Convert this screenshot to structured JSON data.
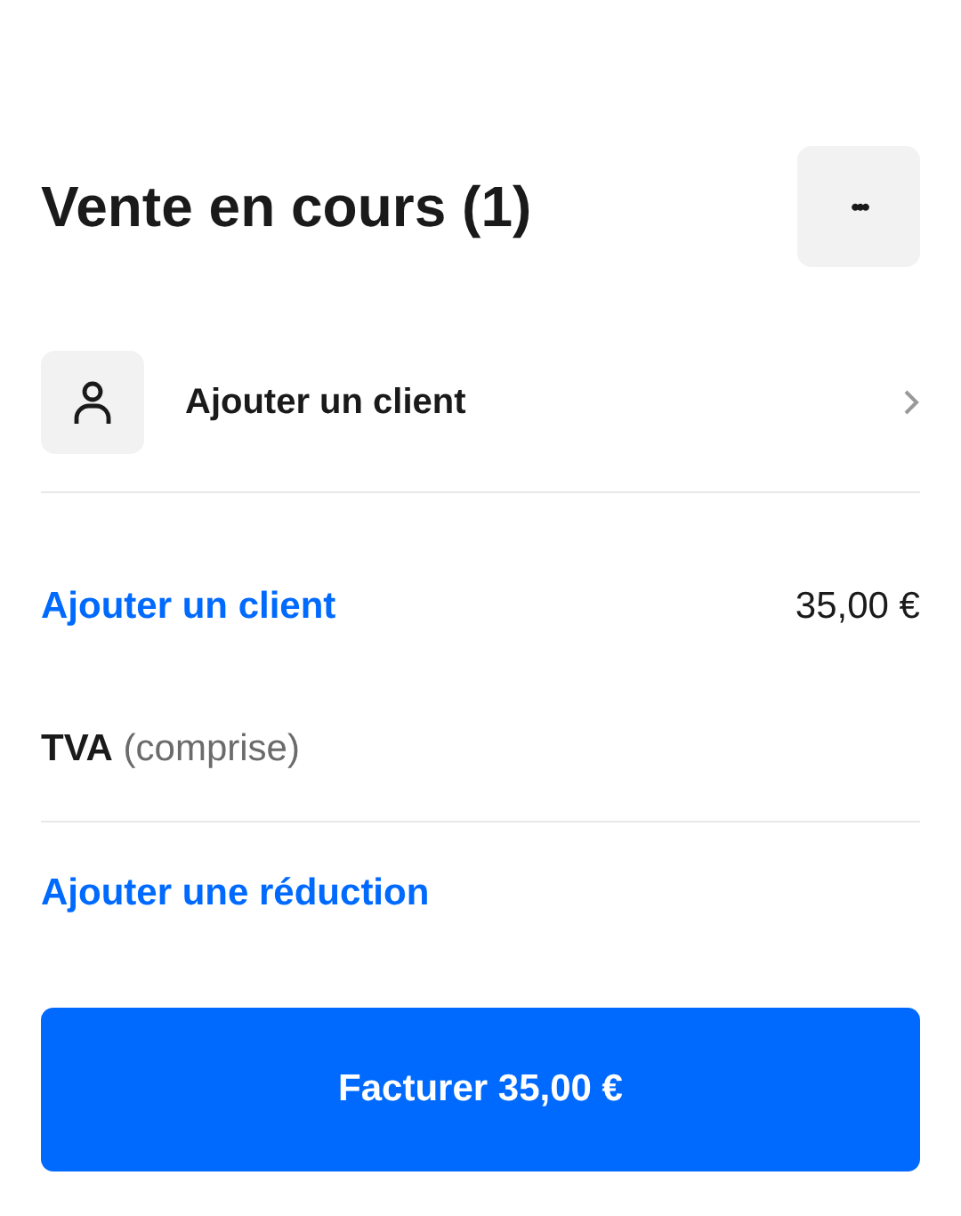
{
  "header": {
    "title": "Vente en cours (1)",
    "more_button": "•••"
  },
  "customer_row": {
    "label": "Ajouter un client"
  },
  "summary": [
    {
      "kind": "line",
      "label": "Ajouter un client",
      "value": "35,00 €"
    },
    {
      "kind": "tax",
      "label": "TVA",
      "note": "(comprise)"
    },
    {
      "kind": "link",
      "label": "Ajouter une réduction"
    }
  ],
  "charge_button": {
    "label": "Facturer 35,00 €"
  }
}
